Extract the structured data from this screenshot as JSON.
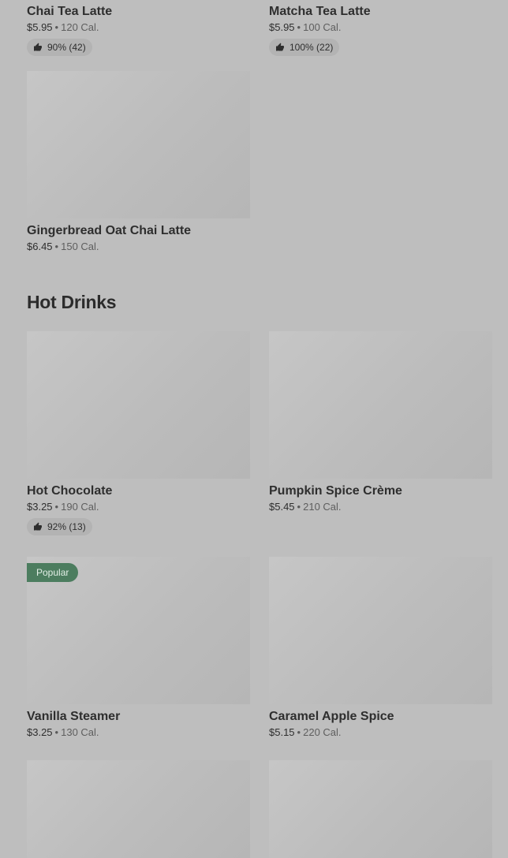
{
  "tea_items": [
    {
      "name": "Chai Tea Latte",
      "price": "$5.95",
      "calories": "120 Cal.",
      "rating": "90% (42)"
    },
    {
      "name": "Matcha Tea Latte",
      "price": "$5.95",
      "calories": "100 Cal.",
      "rating": "100% (22)"
    },
    {
      "name": "Gingerbread Oat Chai Latte",
      "price": "$6.45",
      "calories": "150 Cal."
    }
  ],
  "hot_drinks": {
    "title": "Hot Drinks",
    "items": [
      {
        "name": "Hot Chocolate",
        "price": "$3.25",
        "calories": "190 Cal.",
        "rating": "92% (13)"
      },
      {
        "name": "Pumpkin Spice Crème",
        "price": "$5.45",
        "calories": "210 Cal."
      },
      {
        "name": "Vanilla Steamer",
        "price": "$3.25",
        "calories": "130 Cal.",
        "badge": "Popular"
      },
      {
        "name": "Caramel Apple Spice",
        "price": "$5.15",
        "calories": "220 Cal."
      }
    ]
  },
  "separator": "•",
  "icons": {
    "rating": "thumbs-up-icon"
  },
  "colors": {
    "badge_bg": "#4c7d5f",
    "overlay": "#bebebe"
  }
}
